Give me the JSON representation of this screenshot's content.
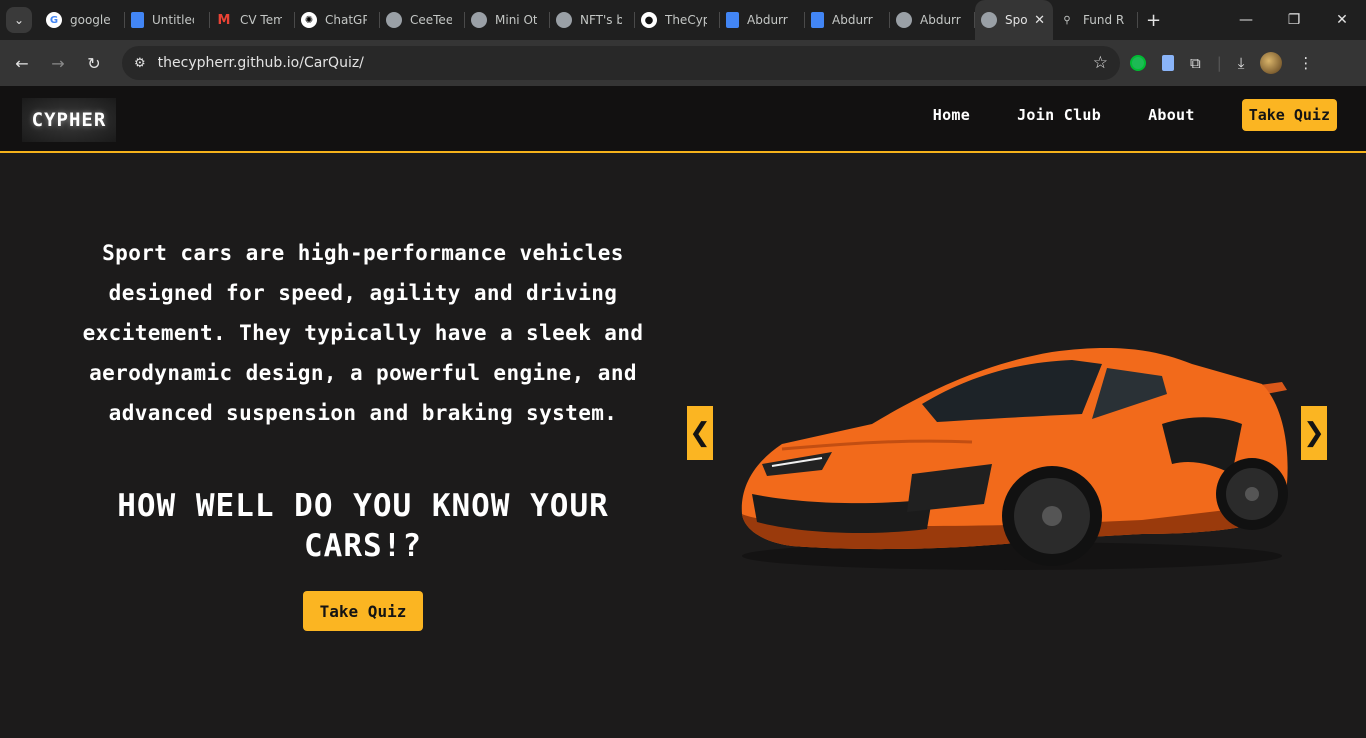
{
  "browser": {
    "tabs": [
      {
        "label": "google",
        "icon": "google-icon"
      },
      {
        "label": "Untitled",
        "icon": "docs-icon"
      },
      {
        "label": "CV Tem",
        "icon": "gmail-icon"
      },
      {
        "label": "ChatGP",
        "icon": "chatgpt-icon"
      },
      {
        "label": "CeeTee",
        "icon": "globe-icon"
      },
      {
        "label": "Mini Ot",
        "icon": "globe-icon"
      },
      {
        "label": "NFT's b",
        "icon": "globe-icon"
      },
      {
        "label": "TheCyp",
        "icon": "github-icon"
      },
      {
        "label": "Abdurr",
        "icon": "docs-icon"
      },
      {
        "label": "Abdurr",
        "icon": "docs-icon"
      },
      {
        "label": "Abdurr",
        "icon": "globe-icon"
      },
      {
        "label": "Spo",
        "icon": "globe-icon",
        "active": true
      },
      {
        "label": "Fund R",
        "icon": "link-icon"
      }
    ],
    "url": "thecypherr.github.io/CarQuiz/"
  },
  "site": {
    "logo": "CYPHER",
    "nav": {
      "home": "Home",
      "join": "Join Club",
      "about": "About",
      "quiz": "Take Quiz"
    },
    "hero": {
      "description": "Sport cars are high-performance vehicles designed for speed, agility and driving excitement. They typically have a sleek and aerodynamic design, a powerful engine, and advanced suspension and braking system.",
      "title": "HOW WELL DO YOU KNOW YOUR CARS!?",
      "button": "Take Quiz"
    },
    "carousel": {
      "prev": "❮",
      "next": "❯"
    }
  },
  "colors": {
    "accent": "#fbb522",
    "background": "#1c1b1b",
    "header": "#121111",
    "car_body": "#f26a1b"
  }
}
